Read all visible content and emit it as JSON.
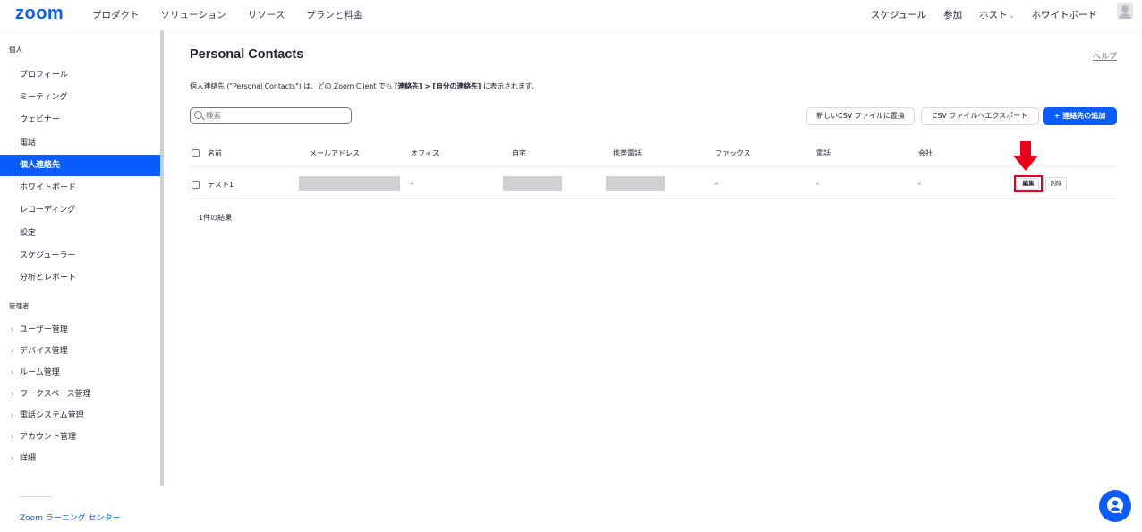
{
  "brand": {
    "logo": "zoom",
    "accent": "#0b5cff",
    "highlight": "#e8001d"
  },
  "nav": {
    "left": [
      "プロダクト",
      "ソリューション",
      "リソース",
      "プランと料金"
    ],
    "right": [
      "スケジュール",
      "参加",
      "ホスト",
      "ホワイトボード"
    ]
  },
  "sidebar": {
    "personal_label": "個人",
    "personal_items": [
      "プロフィール",
      "ミーティング",
      "ウェビナー",
      "電話",
      "個人連絡先",
      "ホワイトボード",
      "レコーディング",
      "設定",
      "スケジューラー",
      "分析とレポート"
    ],
    "active_item": "個人連絡先",
    "admin_label": "管理者",
    "admin_items": [
      "ユーザー管理",
      "デバイス管理",
      "ルーム管理",
      "ワークスペース管理",
      "電話システム管理",
      "アカウント管理",
      "詳細"
    ],
    "learning_center": "Zoom ラーニング センター"
  },
  "main": {
    "title": "Personal Contacts",
    "help": "ヘルプ",
    "desc_start": "個人連絡先 (\"Personal Contacts\") は、どの Zoom Client でも ",
    "desc_bold": "[連絡先] > [自分の連絡先]",
    "desc_end": " に表示されます。",
    "search_placeholder": "検索",
    "btn_replace": "新しいCSV ファイルに置換",
    "btn_export": "CSV ファイルへエクスポート",
    "btn_add": "+  連絡先の追加",
    "columns": [
      "名前",
      "メールアドレス",
      "オフィス",
      "自宅",
      "携帯電話",
      "ファックス",
      "電話",
      "会社"
    ],
    "rows": [
      {
        "name": "テスト1",
        "office": "-",
        "fax": "-",
        "phone": "-",
        "company": "-"
      }
    ],
    "edit_label": "編集",
    "delete_label": "削除",
    "result_count": "1件の結果"
  }
}
